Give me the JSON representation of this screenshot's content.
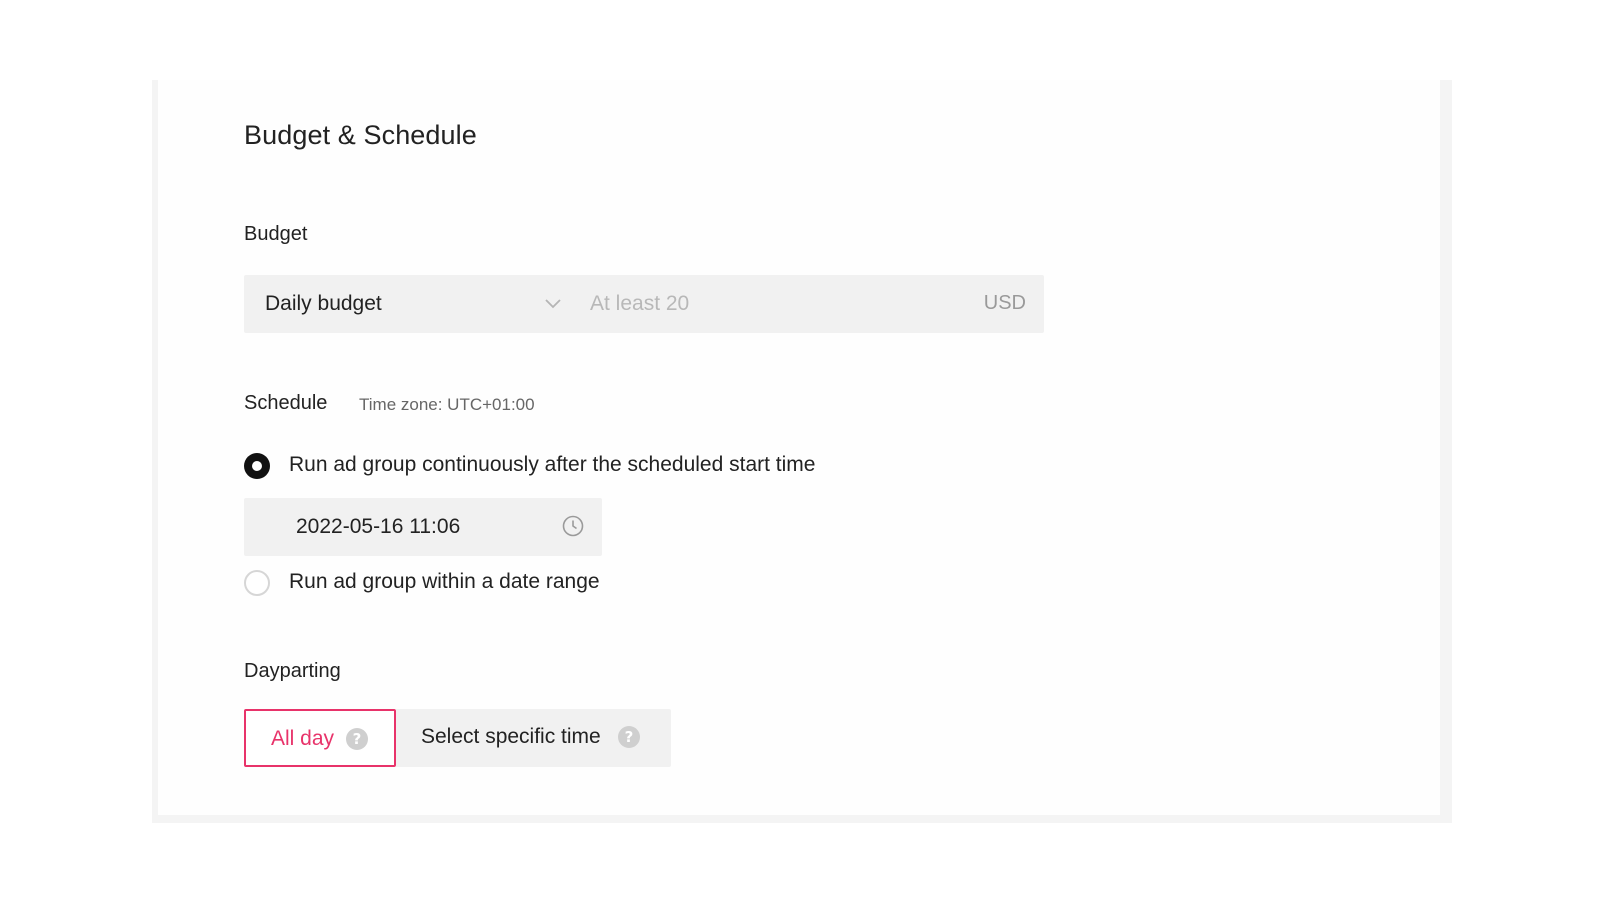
{
  "panel": {
    "title": "Budget & Schedule"
  },
  "budget": {
    "label": "Budget",
    "type_select": {
      "selected": "Daily budget",
      "chevron_icon": "chevron-down-icon"
    },
    "amount_input": {
      "value": "",
      "placeholder": "At least 20"
    },
    "currency": "USD"
  },
  "schedule": {
    "label": "Schedule",
    "timezone": "Time zone: UTC+01:00",
    "options": [
      {
        "label": "Run ad group continuously after the scheduled start time",
        "checked": true
      },
      {
        "label": "Run ad group within a date range",
        "checked": false
      }
    ],
    "start_time": {
      "value": "2022-05-16 11:06",
      "icon": "clock-icon"
    }
  },
  "dayparting": {
    "label": "Dayparting",
    "options": [
      {
        "label": "All day",
        "selected": true,
        "help_icon": "help-icon"
      },
      {
        "label": "Select specific time",
        "selected": false,
        "help_icon": "help-icon"
      }
    ],
    "accent_color": "#e8336a"
  }
}
